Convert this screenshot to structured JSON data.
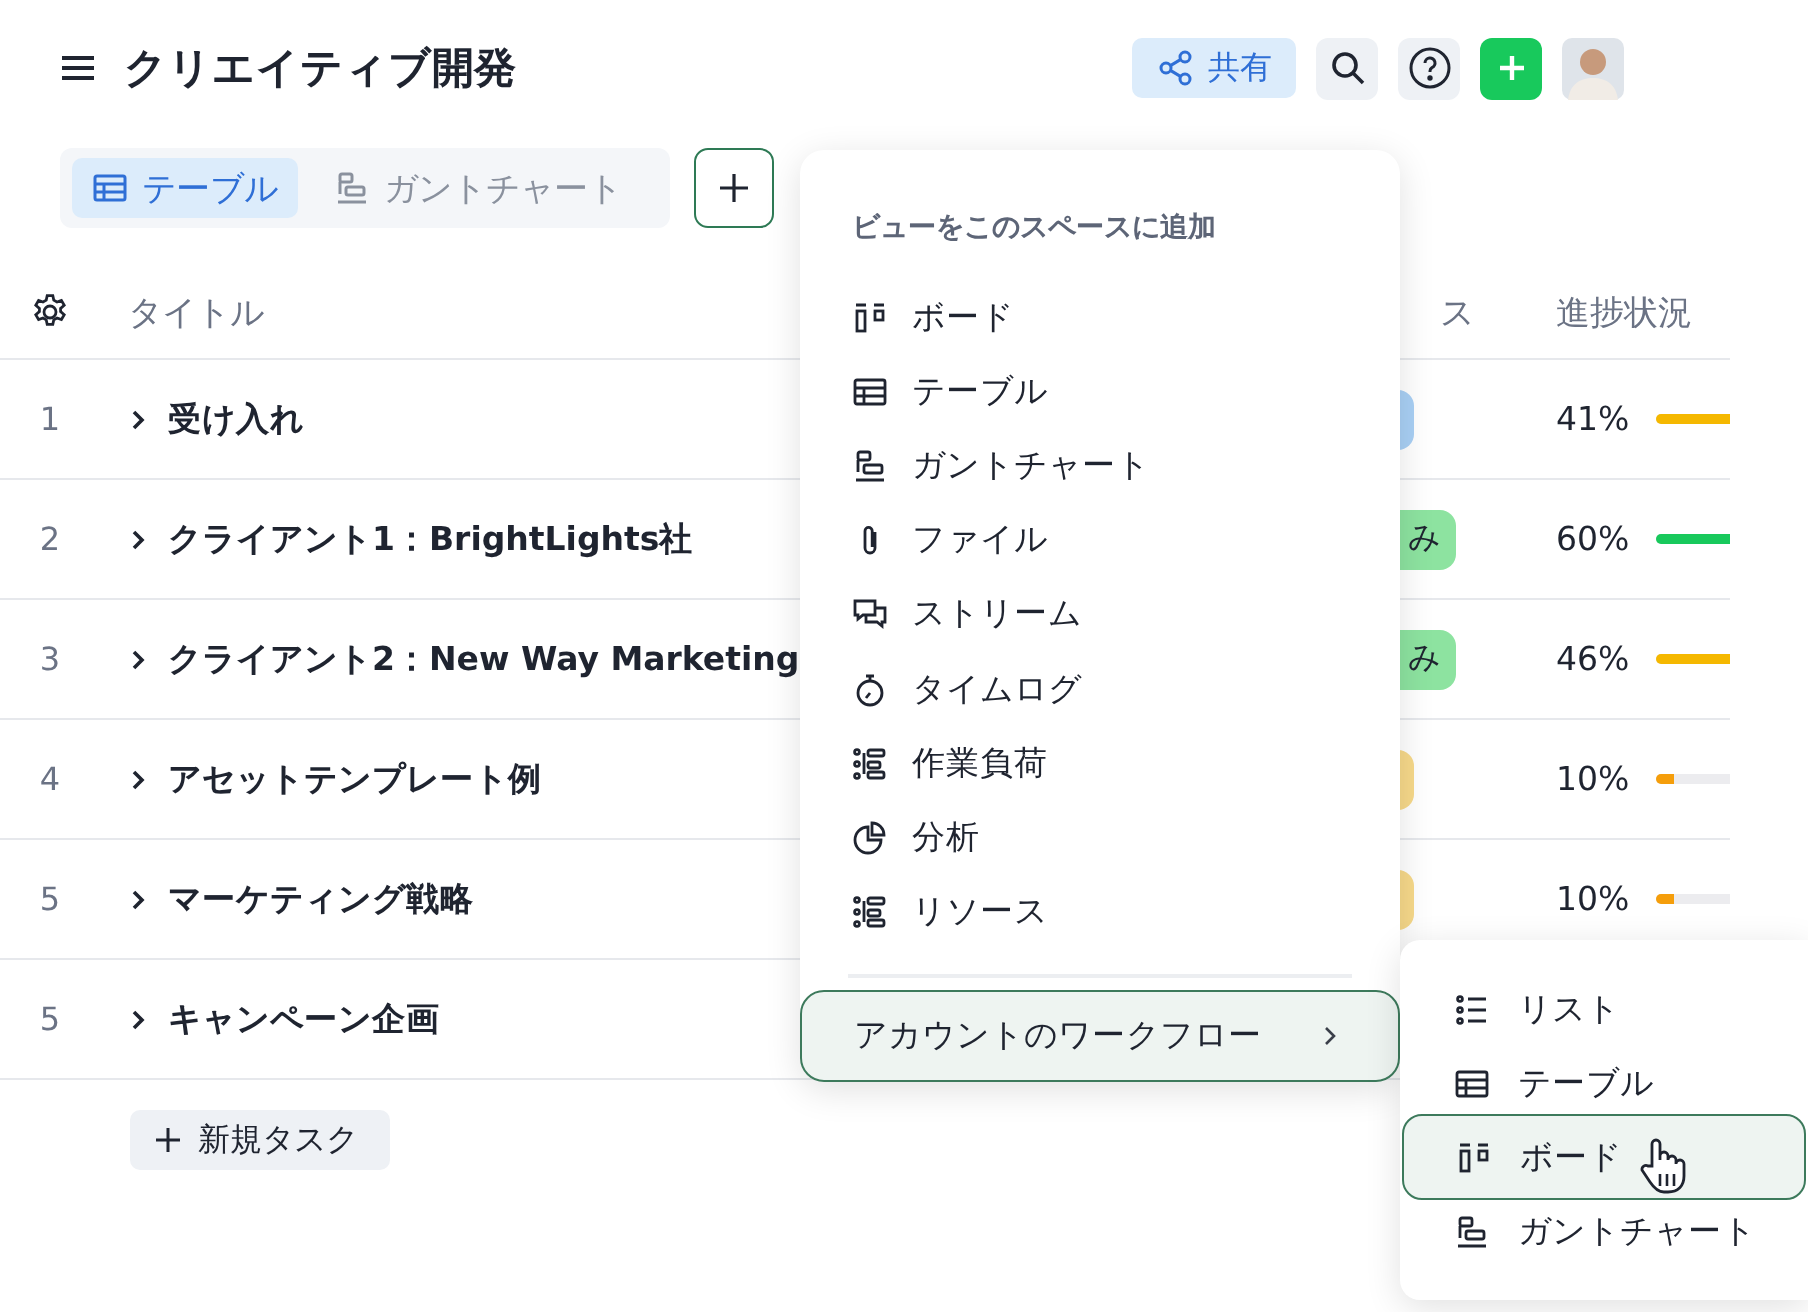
{
  "header": {
    "title": "クリエイティブ開発",
    "share_label": "共有"
  },
  "views": [
    {
      "label": "テーブル",
      "kind": "table",
      "selected": true
    },
    {
      "label": "ガントチャート",
      "kind": "gantt",
      "selected": false
    }
  ],
  "table": {
    "columns": [
      "タイトル",
      "ス",
      "進捗状況"
    ],
    "rows": [
      {
        "number": "1",
        "title": "受け入れ",
        "status": {
          "color": "#a9d0f5"
        },
        "progress": {
          "text": "41%",
          "level": 0.41,
          "color": "#f5b800"
        }
      },
      {
        "number": "2",
        "title": "クライアント1：BrightLights社",
        "status": {
          "color": "#8de3a0",
          "text": "み"
        },
        "progress": {
          "text": "60%",
          "level": 0.6,
          "color": "#18c95c"
        }
      },
      {
        "number": "3",
        "title": "クライアント2：New Way Marketing",
        "status": {
          "color": "#8de3a0",
          "text": "み"
        },
        "progress": {
          "text": "46%",
          "level": 0.46,
          "color": "#f5b800"
        }
      },
      {
        "number": "4",
        "title": "アセットテンプレート例",
        "status": {
          "color": "#f7d98a"
        },
        "progress": {
          "text": "10%",
          "level": 0.1,
          "color": "#f59e0b"
        }
      },
      {
        "number": "5",
        "title": "マーケティング戦略",
        "status": {
          "color": "#f7d98a"
        },
        "progress": {
          "text": "10%",
          "level": 0.1,
          "color": "#f59e0b"
        }
      },
      {
        "number": "5",
        "title": "キャンペーン企画"
      }
    ],
    "new_task": "新規タスク"
  },
  "view_menu": {
    "heading": "ビューをこのスペースに追加",
    "items": [
      {
        "label": "ボード",
        "kind": "board"
      },
      {
        "label": "テーブル",
        "kind": "table"
      },
      {
        "label": "ガントチャート",
        "kind": "gantt"
      },
      {
        "label": "ファイル",
        "kind": "file"
      },
      {
        "label": "ストリーム",
        "kind": "stream"
      },
      {
        "label": "タイムログ",
        "kind": "timelog"
      },
      {
        "label": "作業負荷",
        "kind": "workload"
      },
      {
        "label": "分析",
        "kind": "analytics"
      },
      {
        "label": "リソース",
        "kind": "workload"
      }
    ],
    "workflow": {
      "label": "アカウントのワークフロー",
      "expanded": true
    }
  },
  "workflow_menu": {
    "items": [
      {
        "label": "リスト",
        "kind": "list",
        "selected": false
      },
      {
        "label": "テーブル",
        "kind": "table",
        "selected": false
      },
      {
        "label": "ボード",
        "kind": "board",
        "selected": true
      },
      {
        "label": "ガントチャート",
        "kind": "gantt",
        "selected": false
      }
    ]
  }
}
